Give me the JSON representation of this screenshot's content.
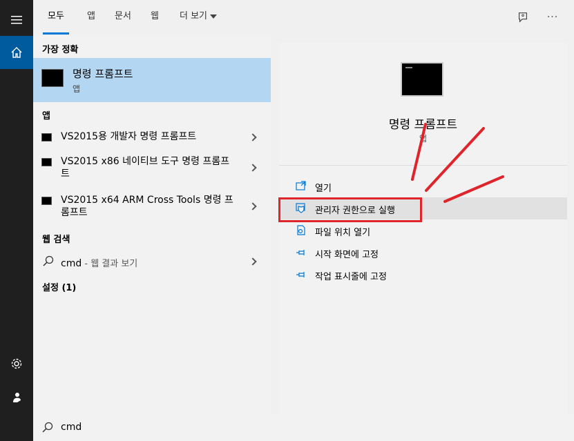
{
  "nav": {
    "items": [
      "home-icon",
      "settings-icon",
      "user-icon"
    ]
  },
  "tabs": [
    {
      "label": "모두"
    },
    {
      "label": "앱"
    },
    {
      "label": "문서"
    },
    {
      "label": "웹"
    },
    {
      "label": "더 보기"
    }
  ],
  "top_icons": [
    "feedback-icon",
    "more-icon"
  ],
  "best_match": {
    "heading": "가장 정확",
    "title": "명령 프롬프트",
    "subtitle": "앱"
  },
  "apps": {
    "heading": "앱",
    "items": [
      {
        "label": "VS2015용 개발자 명령 프롬프트"
      },
      {
        "label": "VS2015 x86 네이티브 도구 명령 프롬프트"
      },
      {
        "label": "VS2015 x64 ARM Cross Tools 명령 프롬프트"
      }
    ]
  },
  "web": {
    "heading": "웹 검색",
    "query": "cmd",
    "hint": " - 웹 결과 보기"
  },
  "settings": {
    "heading": "설정 (1)"
  },
  "detail": {
    "title": "명령 프롬프트",
    "subtitle": "앱",
    "actions": [
      {
        "label": "열기",
        "icon": "open-icon"
      },
      {
        "label": "관리자 권한으로 실행",
        "icon": "shield-icon"
      },
      {
        "label": "파일 위치 열기",
        "icon": "file-location-icon"
      },
      {
        "label": "시작 화면에 고정",
        "icon": "pin-icon"
      },
      {
        "label": "작업 표시줄에 고정",
        "icon": "pin-icon"
      }
    ]
  },
  "search": {
    "value": "cmd"
  },
  "colors": {
    "accent": "#0078d7",
    "highlight": "#b3d7f2",
    "annotation": "#e0242c"
  }
}
